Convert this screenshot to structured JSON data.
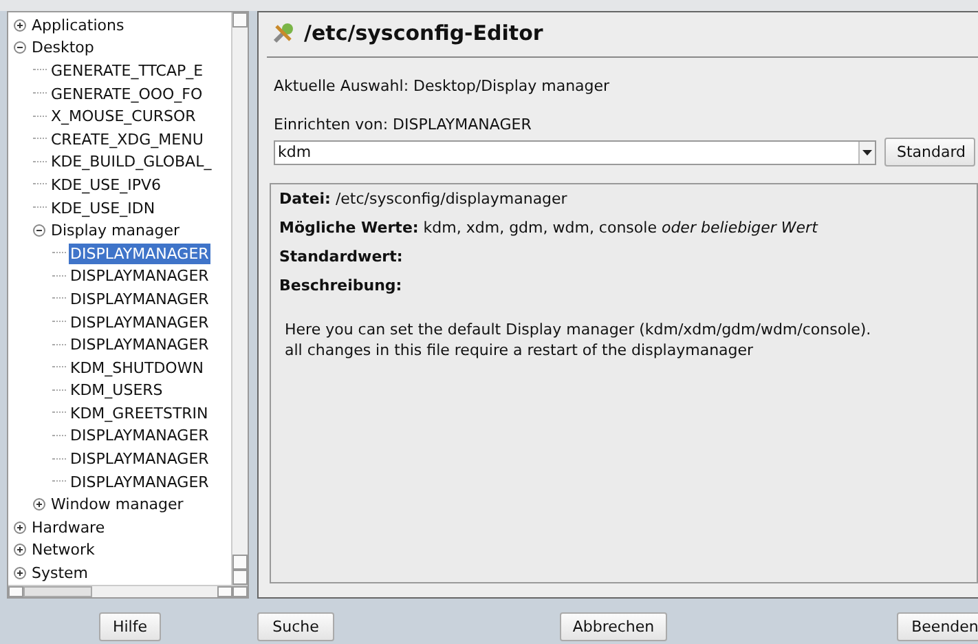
{
  "tree": [
    {
      "label": "Applications",
      "expanded": false
    },
    {
      "label": "Desktop",
      "expanded": true,
      "children": [
        {
          "label": "GENERATE_TTCAP_E",
          "selected": false
        },
        {
          "label": "GENERATE_OOO_FO",
          "selected": false
        },
        {
          "label": "X_MOUSE_CURSOR",
          "selected": false
        },
        {
          "label": "CREATE_XDG_MENU",
          "selected": false
        },
        {
          "label": "KDE_BUILD_GLOBAL_",
          "selected": false
        },
        {
          "label": "KDE_USE_IPV6",
          "selected": false
        },
        {
          "label": "KDE_USE_IDN",
          "selected": false
        },
        {
          "label": "Display manager",
          "expanded": true,
          "children": [
            {
              "label": "DISPLAYMANAGER",
              "selected": true
            },
            {
              "label": "DISPLAYMANAGER",
              "selected": false
            },
            {
              "label": "DISPLAYMANAGER",
              "selected": false
            },
            {
              "label": "DISPLAYMANAGER",
              "selected": false
            },
            {
              "label": "DISPLAYMANAGER",
              "selected": false
            },
            {
              "label": "KDM_SHUTDOWN",
              "selected": false
            },
            {
              "label": "KDM_USERS",
              "selected": false
            },
            {
              "label": "KDM_GREETSTRIN",
              "selected": false
            },
            {
              "label": "DISPLAYMANAGER",
              "selected": false
            },
            {
              "label": "DISPLAYMANAGER",
              "selected": false
            },
            {
              "label": "DISPLAYMANAGER",
              "selected": false
            }
          ]
        },
        {
          "label": "Window manager",
          "expanded": false
        }
      ]
    },
    {
      "label": "Hardware",
      "expanded": false
    },
    {
      "label": "Network",
      "expanded": false
    },
    {
      "label": "System",
      "expanded": false
    }
  ],
  "title": "/etc/sysconfig-Editor",
  "current_selection": "Aktuelle Auswahl: Desktop/Display manager",
  "setting_label": "Einrichten von: DISPLAYMANAGER",
  "value_field": {
    "value": "kdm"
  },
  "default_button": "Standard",
  "info": [
    {
      "kind": "line",
      "text": "**Datei:** /etc/sysconfig/displaymanager"
    },
    {
      "kind": "line",
      "text": "**Mögliche Werte:** kdm, xdm, gdm, wdm, console *oder beliebiger Wert*"
    },
    {
      "kind": "heading",
      "text": "Standardwert:"
    },
    {
      "kind": "heading",
      "text": "Beschreibung:"
    }
  ],
  "description": [
    "Here you can set the default Display manager (kdm/xdm/gdm/wdm/console).",
    "all changes in this file require a restart of the displaymanager"
  ],
  "buttons": [
    "Hilfe",
    "Suche",
    "Abbrechen",
    "Beenden"
  ]
}
